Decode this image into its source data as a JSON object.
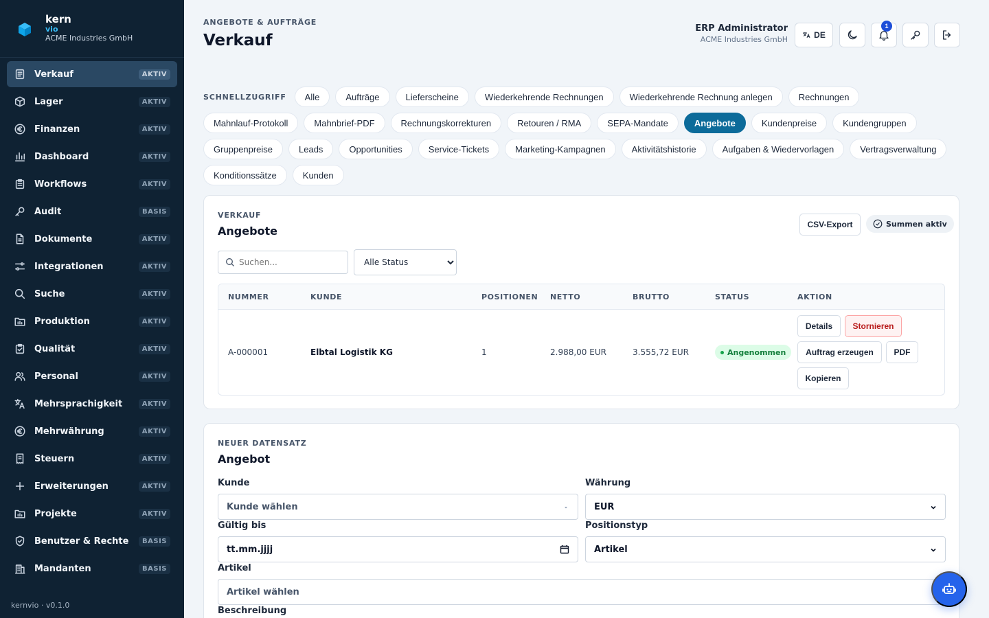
{
  "brand": {
    "name": "kern",
    "sub": "vio",
    "company": "ACME Industries GmbH"
  },
  "sidebar": {
    "items": [
      {
        "label": "Verkauf",
        "badge": "AKTIV",
        "icon": "document-icon"
      },
      {
        "label": "Lager",
        "badge": "AKTIV",
        "icon": "box-icon"
      },
      {
        "label": "Finanzen",
        "badge": "AKTIV",
        "icon": "euro-icon"
      },
      {
        "label": "Dashboard",
        "badge": "AKTIV",
        "icon": "bar-chart-icon"
      },
      {
        "label": "Workflows",
        "badge": "AKTIV",
        "icon": "clipboard-icon"
      },
      {
        "label": "Audit",
        "badge": "BASIS",
        "icon": "key-icon"
      },
      {
        "label": "Dokumente",
        "badge": "AKTIV",
        "icon": "file-icon"
      },
      {
        "label": "Integrationen",
        "badge": "AKTIV",
        "icon": "sliders-icon"
      },
      {
        "label": "Suche",
        "badge": "AKTIV",
        "icon": "search-icon"
      },
      {
        "label": "Produktion",
        "badge": "AKTIV",
        "icon": "folder-chart-icon"
      },
      {
        "label": "Qualität",
        "badge": "AKTIV",
        "icon": "clipboard-check-icon"
      },
      {
        "label": "Personal",
        "badge": "AKTIV",
        "icon": "users-icon"
      },
      {
        "label": "Mehrsprachigkeit",
        "badge": "AKTIV",
        "icon": "translate-icon"
      },
      {
        "label": "Mehrwährung",
        "badge": "AKTIV",
        "icon": "euro-icon"
      },
      {
        "label": "Steuern",
        "badge": "AKTIV",
        "icon": "receipt-icon"
      },
      {
        "label": "Erweiterungen",
        "badge": "AKTIV",
        "icon": "plus-icon"
      },
      {
        "label": "Projekte",
        "badge": "AKTIV",
        "icon": "folder-chart-icon"
      },
      {
        "label": "Benutzer & Rechte",
        "badge": "BASIS",
        "icon": "shield-icon"
      },
      {
        "label": "Mandanten",
        "badge": "BASIS",
        "icon": "building-icon"
      }
    ],
    "version": "kernvio · v0.1.0"
  },
  "header": {
    "kicker": "ANGEBOTE & AUFTRÄGE",
    "title": "Verkauf",
    "user_name": "ERP Administrator",
    "user_company": "ACME Industries GmbH",
    "lang": "DE",
    "notifications": "1"
  },
  "quick": {
    "label": "SCHNELLZUGRIFF",
    "active": "Angebote",
    "items": [
      "Alle",
      "Aufträge",
      "Lieferscheine",
      "Wiederkehrende Rechnungen",
      "Wiederkehrende Rechnung anlegen",
      "Rechnungen",
      "Mahnlauf-Protokoll",
      "Mahnbrief-PDF",
      "Rechnungskorrekturen",
      "Retouren / RMA",
      "SEPA-Mandate",
      "Angebote",
      "Kundenpreise",
      "Kundengruppen",
      "Gruppenpreise",
      "Leads",
      "Opportunities",
      "Service-Tickets",
      "Marketing-Kampagnen",
      "Aktivitätshistorie",
      "Aufgaben & Wiedervorlagen",
      "Vertragsverwaltung",
      "Konditionssätze",
      "Kunden"
    ]
  },
  "list": {
    "kicker": "VERKAUF",
    "title": "Angebote",
    "csv": "CSV-Export",
    "sum": "Summen aktiv",
    "search_placeholder": "Suchen...",
    "status_filter": "Alle Status",
    "columns": [
      "NUMMER",
      "KUNDE",
      "POSITIONEN",
      "NETTO",
      "BRUTTO",
      "STATUS",
      "AKTION"
    ],
    "rows": [
      {
        "nummer": "A-000001",
        "kunde": "Elbtal Logistik KG",
        "positionen": "1",
        "netto": "2.988,00 EUR",
        "brutto": "3.555,72 EUR",
        "status": "Angenommen"
      }
    ],
    "actions": {
      "details": "Details",
      "storno": "Stornieren",
      "auftrag": "Auftrag erzeugen",
      "pdf": "PDF",
      "kopieren": "Kopieren"
    }
  },
  "form": {
    "kicker": "NEUER DATENSATZ",
    "title": "Angebot",
    "kunde_label": "Kunde",
    "kunde_placeholder": "Kunde wählen",
    "waehrung_label": "Währung",
    "waehrung_value": "EUR",
    "gueltig_label": "Gültig bis",
    "gueltig_value": "tt.mm.jjjj",
    "positionstyp_label": "Positionstyp",
    "positionstyp_value": "Artikel",
    "artikel_label": "Artikel",
    "artikel_placeholder": "Artikel wählen",
    "beschreibung_label": "Beschreibung"
  },
  "colors": {
    "sidebar": "#0f2233",
    "accent": "#0c6b9a",
    "fab": "#2563eb",
    "success": "#15803d",
    "danger": "#b91c1c"
  }
}
